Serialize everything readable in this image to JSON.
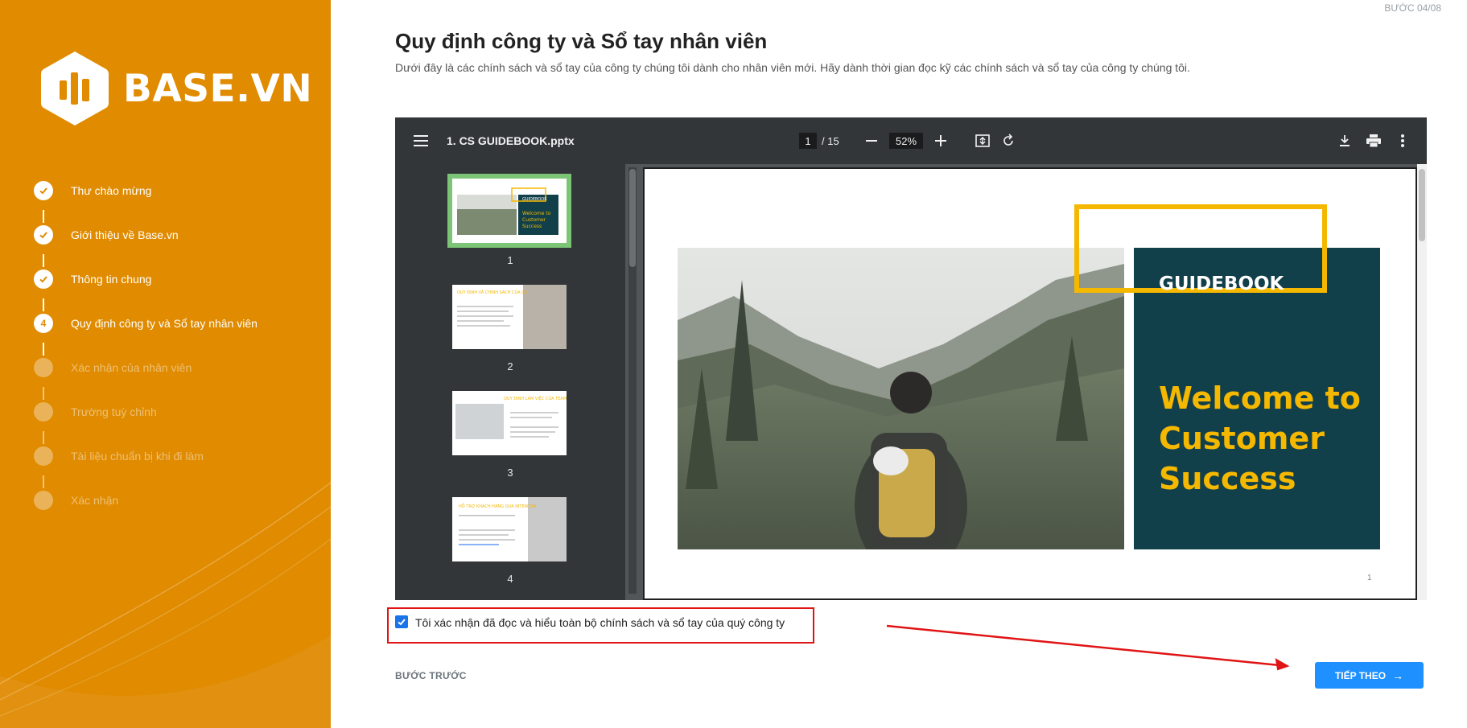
{
  "brand": {
    "name": "BASE.VN",
    "color": "#e08b00"
  },
  "sidebar": {
    "steps": [
      {
        "label": "Thư chào mừng",
        "state": "done",
        "icon": "check-icon"
      },
      {
        "label": "Giới thiệu về Base.vn",
        "state": "done",
        "icon": "check-icon"
      },
      {
        "label": "Thông tin chung",
        "state": "done",
        "icon": "check-icon"
      },
      {
        "label": "Quy định công ty và Sổ tay nhân viên",
        "state": "current",
        "number": "4"
      },
      {
        "label": "Xác nhận của nhân viên",
        "state": "pending"
      },
      {
        "label": "Trường tuỳ chỉnh",
        "state": "pending"
      },
      {
        "label": "Tài liệu chuẩn bị khi đi làm",
        "state": "pending"
      },
      {
        "label": "Xác nhận",
        "state": "pending"
      }
    ]
  },
  "header": {
    "step_counter": "BƯỚC 04/08",
    "title": "Quy định công ty và Sổ tay nhân viên",
    "description": "Dưới đây là các chính sách và sổ tay của công ty chúng tôi dành cho nhân viên mới. Hãy dành thời gian đọc kỹ các chính sách và sổ tay của công ty chúng tôi."
  },
  "viewer": {
    "file_name": "1. CS GUIDEBOOK.pptx",
    "current_page": "1",
    "total_pages": "/ 15",
    "zoom": "52%",
    "thumbnails": [
      {
        "number": "1",
        "title": "GUIDEBOOK",
        "subtitle": "Welcome to Customer Success"
      },
      {
        "number": "2",
        "title": "QUY ĐỊNH VÀ CHÍNH SÁCH CỦA CS"
      },
      {
        "number": "3",
        "title": "QUY ĐỊNH LÀM VIỆC CỦA TEAM MẶM NON"
      },
      {
        "number": "4",
        "title": "HỖ TRỢ KHÁCH HÀNG QUA INTERCOM"
      }
    ],
    "slide": {
      "label": "GUIDEBOOK",
      "welcome": "Welcome to\nCustomer\nSuccess",
      "page_number": "1"
    }
  },
  "confirm": {
    "checked": true,
    "label": "Tôi xác nhận đã đọc và hiểu toàn bộ chính sách và sổ tay của quý công ty"
  },
  "nav": {
    "prev_label": "BƯỚC TRƯỚC",
    "next_label": "TIẾP THEO"
  },
  "colors": {
    "accent_blue": "#1e90ff",
    "annotation_red": "#e01414",
    "slide_teal": "#12404a",
    "slide_gold": "#f5b800"
  }
}
